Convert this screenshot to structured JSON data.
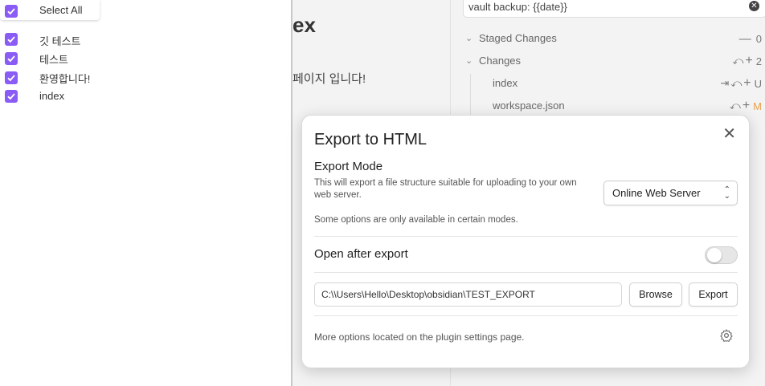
{
  "tree": {
    "select_all_label": "Select All",
    "items": [
      {
        "label": "깃 테스트"
      },
      {
        "label": "테스트"
      },
      {
        "label": "환영합니다!"
      },
      {
        "label": "index"
      }
    ]
  },
  "editor": {
    "title_fragment": "ex",
    "text_fragment": "페이지 입니다!"
  },
  "git": {
    "commit_message": "vault backup: {{date}}",
    "staged_label": "Staged Changes",
    "staged_count": "0",
    "changes_label": "Changes",
    "changes_count": "2",
    "files": [
      {
        "name": "index",
        "status": "U"
      },
      {
        "name": "workspace.json",
        "status": "M"
      }
    ],
    "status_colors": {
      "U": "#777777",
      "M": "#e8a04a"
    }
  },
  "modal": {
    "title": "Export to HTML",
    "mode_heading": "Export Mode",
    "mode_description": "This will export a file structure suitable for uploading to your own web server.",
    "mode_selected": "Online Web Server",
    "mode_note": "Some options are only available in certain modes.",
    "open_after_label": "Open after export",
    "open_after_enabled": false,
    "export_path": "C:\\\\Users\\Hello\\Desktop\\obsidian\\TEST_EXPORT",
    "browse_label": "Browse",
    "export_label": "Export",
    "more_options_note": "More options located on the plugin settings page."
  },
  "colors": {
    "accent": "#8a5cf5"
  },
  "icons": [
    "checkbox-icon",
    "clear-icon",
    "chevron-down-icon",
    "undo-icon",
    "plus-icon",
    "minus-icon",
    "open-file-icon",
    "close-icon",
    "gear-icon"
  ]
}
